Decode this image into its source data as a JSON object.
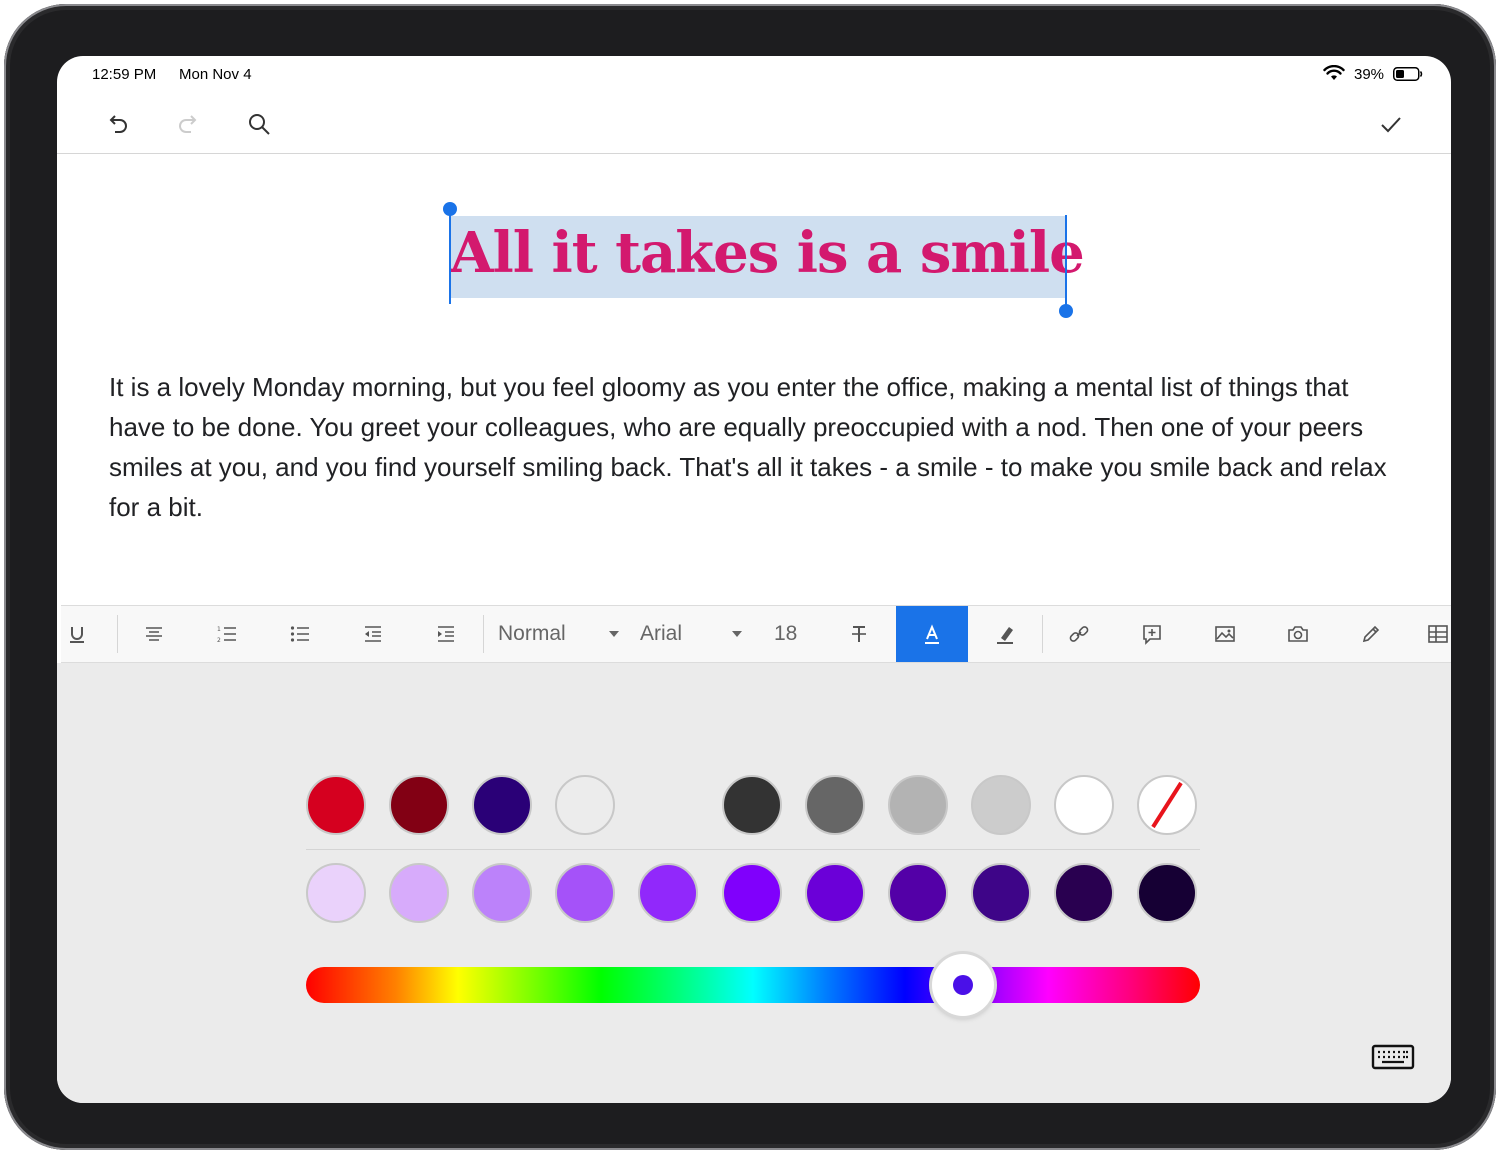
{
  "status_bar": {
    "time": "12:59 PM",
    "date": "Mon Nov 4",
    "battery_percent": "39%",
    "battery_level": 0.39
  },
  "top_toolbar": {
    "undo_icon": "undo-arrow",
    "redo_icon": "redo-arrow",
    "search_icon": "magnifier",
    "done_icon": "checkmark"
  },
  "document": {
    "title": "All it takes is a smile",
    "title_color": "#d3196e",
    "body": "It is a lovely Monday morning, but you feel gloomy as you enter the office, making a mental list of things that have to be done. You greet your colleagues, who are equally preoccupied with a nod. Then one of your peers smiles at you, and you find yourself smiling back. That's all it takes - a smile - to make you smile back and relax for a bit."
  },
  "format_toolbar": {
    "style": "Normal",
    "font": "Arial",
    "size": "18",
    "icons": [
      "underline-icon",
      "align-center-icon",
      "numbered-list-icon",
      "bulleted-list-icon",
      "decrease-indent-icon",
      "increase-indent-icon",
      "clear-formatting-icon",
      "text-color-icon",
      "highlight-icon",
      "link-icon",
      "comment-icon",
      "image-icon",
      "camera-icon",
      "draw-icon",
      "table-icon"
    ],
    "active": "text-color-icon",
    "accent_color": "#1a73e8"
  },
  "color_panel": {
    "recent_colors": [
      "#d5001f",
      "#820014",
      "#2a0077",
      "#ececec"
    ],
    "grayscale_colors": [
      "#333333",
      "#666666",
      "#b3b3b3",
      "#cccccc",
      "#ffffff",
      "none"
    ],
    "shade_colors": [
      "#ead2fb",
      "#d7abfb",
      "#bc82fa",
      "#a552f9",
      "#9128fb",
      "#8000fc",
      "#6b00d8",
      "#5300a7",
      "#3e0588",
      "#290050",
      "#160034"
    ],
    "hue_position": 0.735,
    "selected_hue_color": "#4a10e8"
  }
}
